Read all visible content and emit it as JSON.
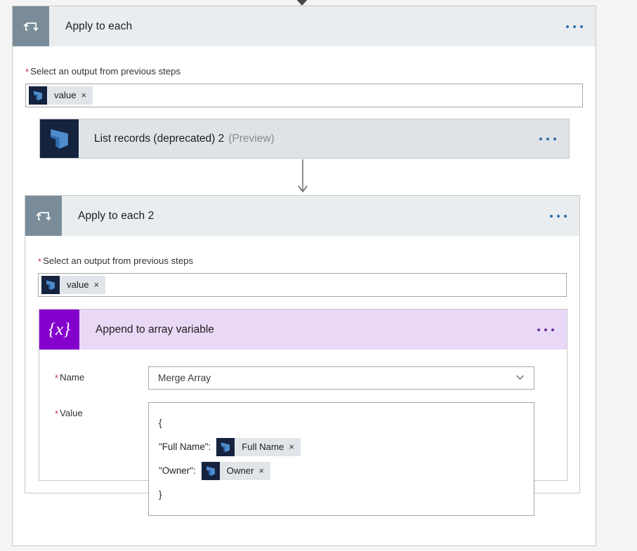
{
  "theme": {
    "loop_icon_bg": "#7a8c99",
    "loop_header_bg": "#e9edf0",
    "dynamics_icon_bg": "#15233f",
    "action_bg": "#dfe3e8",
    "variable_icon_bg": "#8400cc",
    "variable_header_bg": "#e9d9f7",
    "required_color": "#c4314b",
    "ellipsis_color": "#2f6fa8",
    "canvas_bg": "#f4f4f4"
  },
  "outer_loop": {
    "title": "Apply to each",
    "icon": "loop-icon",
    "menu": "ellipsis-icon",
    "input_label": "Select an output from previous steps",
    "required_marker": "*",
    "token": {
      "text": "value",
      "icon": "dynamics365-icon",
      "remove": "×"
    }
  },
  "action": {
    "title": "List records (deprecated) 2",
    "subtitle": "(Preview)",
    "icon": "dynamics365-icon",
    "menu": "ellipsis-icon"
  },
  "inner_loop": {
    "title": "Apply to each 2",
    "icon": "loop-icon",
    "menu": "ellipsis-icon",
    "input_label": "Select an output from previous steps",
    "required_marker": "*",
    "token": {
      "text": "value",
      "icon": "dynamics365-icon",
      "remove": "×"
    }
  },
  "append_action": {
    "title": "Append to array variable",
    "icon": "{x}",
    "menu": "ellipsis-icon",
    "name_field": {
      "label": "Name",
      "required_marker": "*",
      "value": "Merge Array",
      "chevron": "chevron-down-icon"
    },
    "value_field": {
      "label": "Value",
      "required_marker": "*",
      "lines": [
        {
          "type": "text",
          "text": "{"
        },
        {
          "type": "token_line",
          "key": "\"Full Name\":",
          "token": {
            "text": "Full Name",
            "icon": "dynamics365-icon",
            "remove": "×"
          }
        },
        {
          "type": "token_line",
          "key": "\"Owner\":",
          "token": {
            "text": "Owner",
            "icon": "dynamics365-icon",
            "remove": "×"
          }
        },
        {
          "type": "text",
          "text": "}"
        }
      ]
    }
  },
  "connectors": [
    {
      "name": "connector-top-into-apply-to-each"
    },
    {
      "name": "connector-list-records-to-apply-to-each-2"
    }
  ]
}
